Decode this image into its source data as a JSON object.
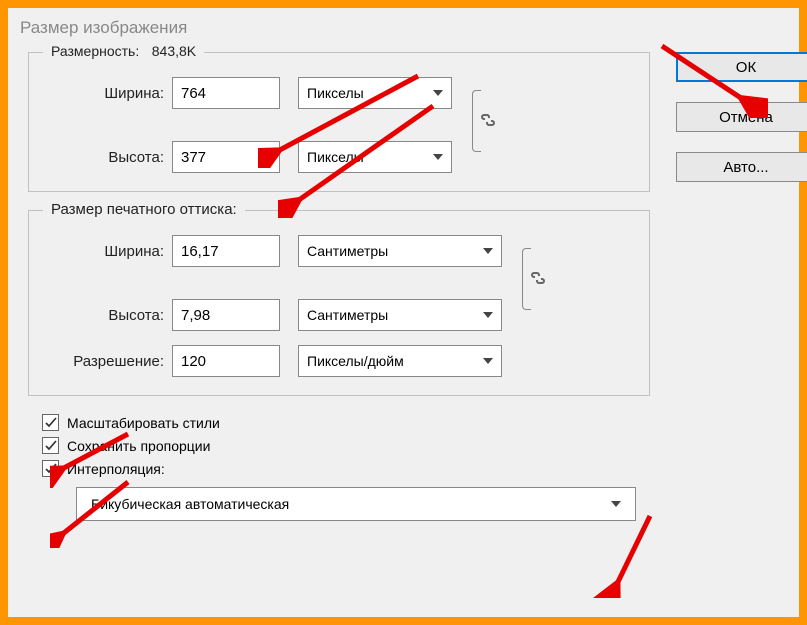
{
  "title": "Размер изображения",
  "pixel": {
    "legend_prefix": "Размерность:",
    "filesize": "843,8K",
    "width_label": "Ширина:",
    "width_value": "764",
    "height_label": "Высота:",
    "height_value": "377",
    "unit": "Пикселы"
  },
  "print": {
    "legend": "Размер печатного оттиска:",
    "width_label": "Ширина:",
    "width_value": "16,17",
    "height_label": "Высота:",
    "height_value": "7,98",
    "unit": "Сантиметры",
    "res_label": "Разрешение:",
    "res_value": "120",
    "res_unit": "Пикселы/дюйм"
  },
  "checks": {
    "scale_styles": "Масштабировать стили",
    "constrain": "Сохранить пропорции",
    "resample": "Интерполяция:"
  },
  "interp_method": "Бикубическая автоматическая",
  "buttons": {
    "ok": "ОК",
    "cancel": "Отмена",
    "auto": "Авто..."
  }
}
